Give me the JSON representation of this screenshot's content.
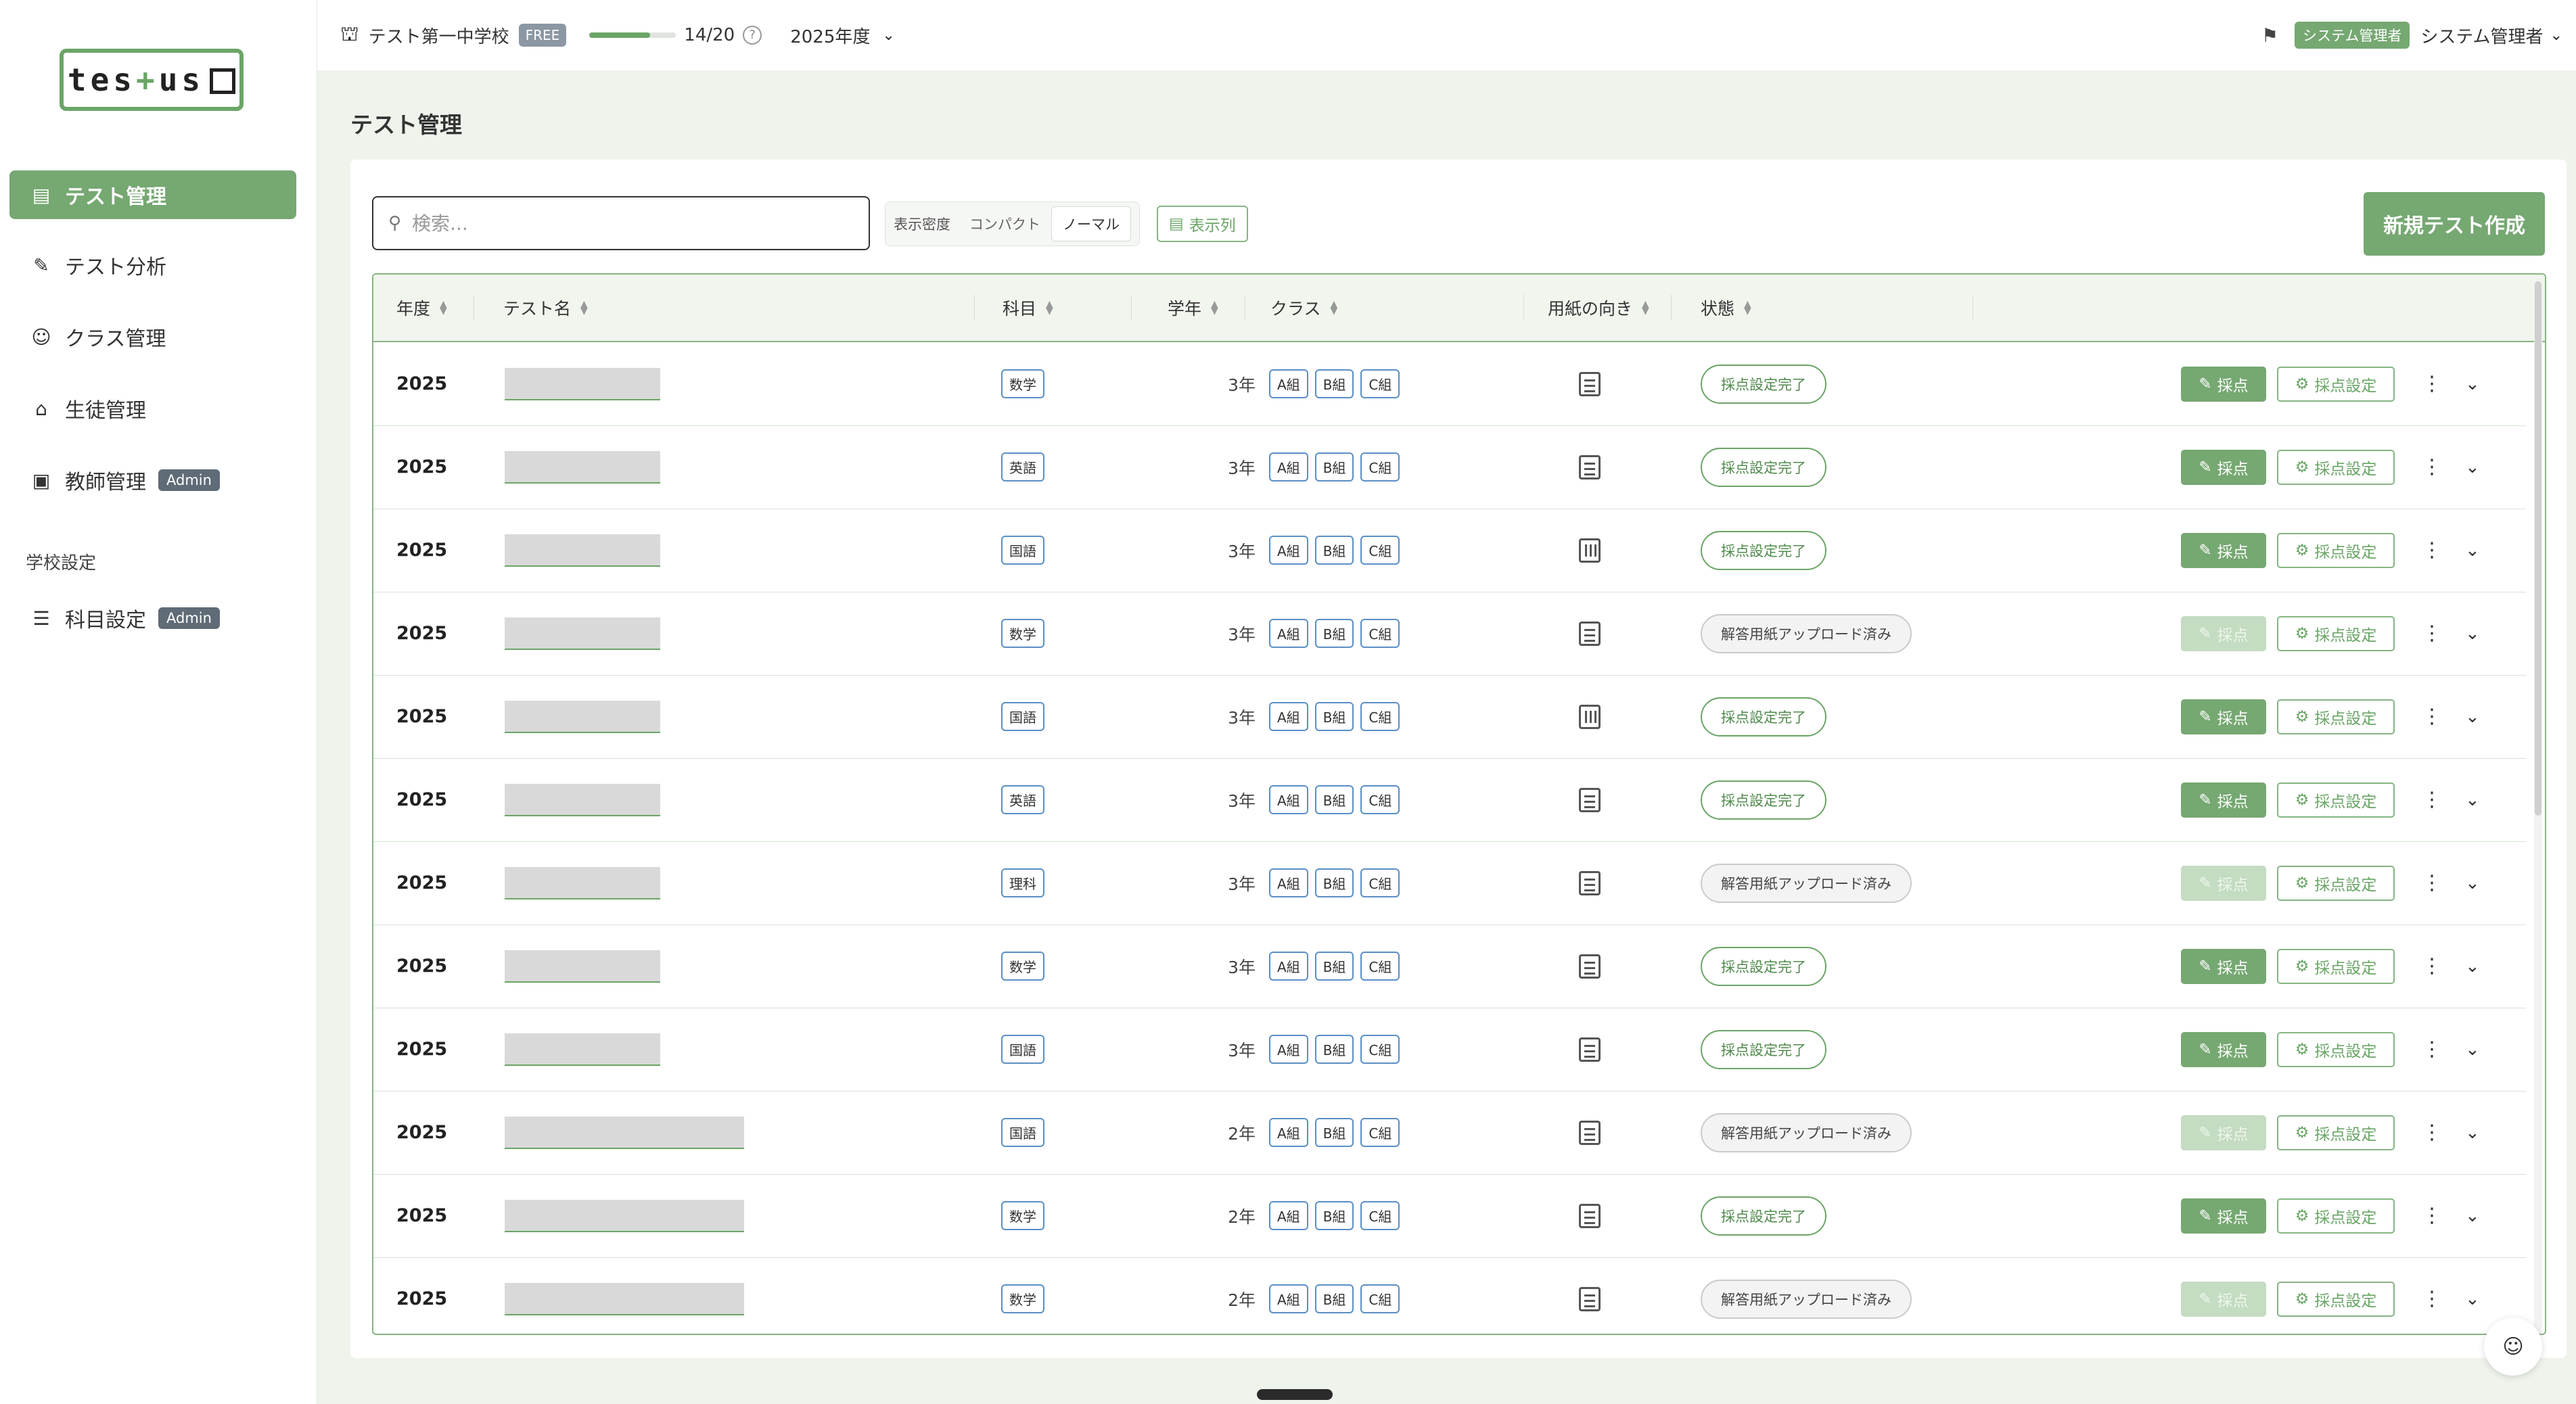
{
  "sidebar": {
    "logo": {
      "part1": "tes",
      "plus": "+",
      "part2": "us"
    },
    "items": [
      {
        "label": "テスト管理",
        "icon": "document-icon",
        "active": true
      },
      {
        "label": "テスト分析",
        "icon": "chart-icon"
      },
      {
        "label": "クラス管理",
        "icon": "users-icon"
      },
      {
        "label": "生徒管理",
        "icon": "graduation-cap-icon"
      },
      {
        "label": "教師管理",
        "icon": "teacher-board-icon",
        "badge": "Admin"
      }
    ],
    "section_label": "学校設定",
    "settings_items": [
      {
        "label": "科目設定",
        "icon": "list-icon",
        "badge": "Admin"
      }
    ]
  },
  "topbar": {
    "school": "テスト第一中学校",
    "plan": "FREE",
    "usage_fraction": 0.7,
    "usage_text": "14/20",
    "year": "2025年度",
    "role": "システム管理者",
    "user": "システム管理者"
  },
  "page_title": "テスト管理",
  "toolbar": {
    "search_placeholder": "検索...",
    "density_label": "表示密度",
    "density_options": [
      "コンパクト",
      "ノーマル"
    ],
    "density_selected": "ノーマル",
    "columns_label": "表示列",
    "new_test_label": "新規テスト作成"
  },
  "table": {
    "headers": {
      "year": "年度",
      "name": "テスト名",
      "subject": "科目",
      "grade": "学年",
      "class": "クラス",
      "paper": "用紙の向き",
      "status": "状態"
    },
    "grade_button": "採点",
    "settings_button": "採点設定",
    "rows": [
      {
        "year": "2025",
        "subject": "数学",
        "grade": "3年",
        "classes": [
          "A組",
          "B組",
          "C組"
        ],
        "paper": "vertical-paper-icon",
        "status": "採点設定完了",
        "status_kind": "done"
      },
      {
        "year": "2025",
        "subject": "英語",
        "grade": "3年",
        "classes": [
          "A組",
          "B組",
          "C組"
        ],
        "paper": "vertical-paper-icon",
        "status": "採点設定完了",
        "status_kind": "done"
      },
      {
        "year": "2025",
        "subject": "国語",
        "grade": "3年",
        "classes": [
          "A組",
          "B組",
          "C組"
        ],
        "paper": "horizontal-paper-icon",
        "status": "採点設定完了",
        "status_kind": "done"
      },
      {
        "year": "2025",
        "subject": "数学",
        "grade": "3年",
        "classes": [
          "A組",
          "B組",
          "C組"
        ],
        "paper": "vertical-paper-icon",
        "status": "解答用紙アップロード済み",
        "status_kind": "uploaded"
      },
      {
        "year": "2025",
        "subject": "国語",
        "grade": "3年",
        "classes": [
          "A組",
          "B組",
          "C組"
        ],
        "paper": "horizontal-paper-icon",
        "status": "採点設定完了",
        "status_kind": "done"
      },
      {
        "year": "2025",
        "subject": "英語",
        "grade": "3年",
        "classes": [
          "A組",
          "B組",
          "C組"
        ],
        "paper": "vertical-paper-icon",
        "status": "採点設定完了",
        "status_kind": "done"
      },
      {
        "year": "2025",
        "subject": "理科",
        "grade": "3年",
        "classes": [
          "A組",
          "B組",
          "C組"
        ],
        "paper": "vertical-paper-icon",
        "status": "解答用紙アップロード済み",
        "status_kind": "uploaded"
      },
      {
        "year": "2025",
        "subject": "数学",
        "grade": "3年",
        "classes": [
          "A組",
          "B組",
          "C組"
        ],
        "paper": "vertical-paper-icon",
        "status": "採点設定完了",
        "status_kind": "done"
      },
      {
        "year": "2025",
        "subject": "国語",
        "grade": "3年",
        "classes": [
          "A組",
          "B組",
          "C組"
        ],
        "paper": "vertical-paper-icon",
        "status": "採点設定完了",
        "status_kind": "done"
      },
      {
        "year": "2025",
        "subject": "国語",
        "grade": "2年",
        "classes": [
          "A組",
          "B組",
          "C組"
        ],
        "paper": "vertical-paper-icon",
        "status": "解答用紙アップロード済み",
        "status_kind": "uploaded"
      },
      {
        "year": "2025",
        "subject": "数学",
        "grade": "2年",
        "classes": [
          "A組",
          "B組",
          "C組"
        ],
        "paper": "vertical-paper-icon",
        "status": "採点設定完了",
        "status_kind": "done"
      },
      {
        "year": "2025",
        "subject": "数学",
        "grade": "2年",
        "classes": [
          "A組",
          "B組",
          "C組"
        ],
        "paper": "vertical-paper-icon",
        "status": "解答用紙アップロード済み",
        "status_kind": "uploaded"
      }
    ]
  },
  "colors": {
    "accent": "#76a872",
    "accent_dark": "#6aa566",
    "tag_border": "#5a8fc4",
    "page_bg": "#eef4ec"
  }
}
